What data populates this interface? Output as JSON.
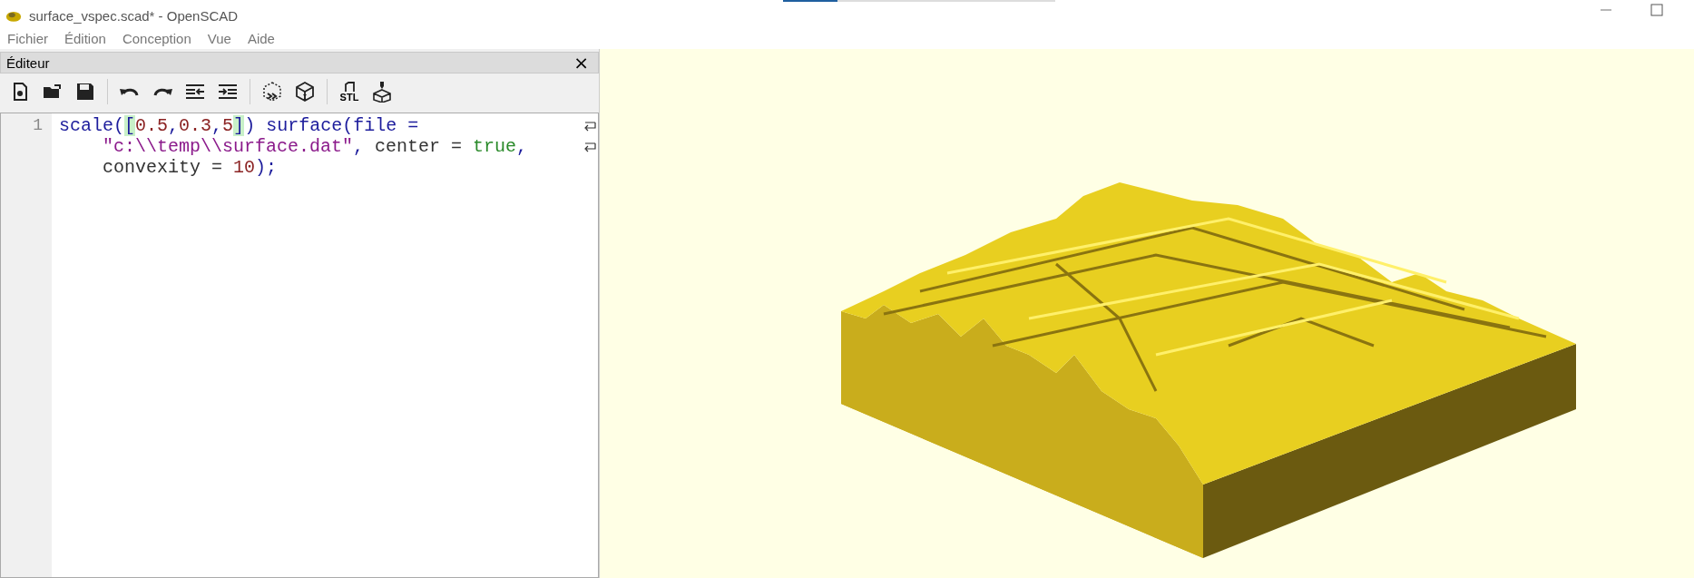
{
  "window": {
    "title": "surface_vspec.scad* - OpenSCAD"
  },
  "menu": [
    "Fichier",
    "Édition",
    "Conception",
    "Vue",
    "Aide"
  ],
  "editor": {
    "title": "Éditeur",
    "close": "×",
    "toolbar": [
      {
        "kind": "new"
      },
      {
        "kind": "open"
      },
      {
        "kind": "save"
      },
      {
        "kind": "separator"
      },
      {
        "kind": "undo"
      },
      {
        "kind": "redo"
      },
      {
        "kind": "unindent"
      },
      {
        "kind": "indent"
      },
      {
        "kind": "separator"
      },
      {
        "kind": "preview"
      },
      {
        "kind": "render"
      },
      {
        "kind": "separator"
      },
      {
        "kind": "export",
        "label": "STL"
      },
      {
        "kind": "print"
      }
    ],
    "lines": [
      {
        "number": "1",
        "rows": [
          {
            "wrapped": true,
            "segments": [
              {
                "kind": "code",
                "text": "scale("
              },
              {
                "kind": "match",
                "text": "["
              },
              {
                "kind": "number",
                "text": "0.5"
              },
              {
                "kind": "code",
                "text": ","
              },
              {
                "kind": "number",
                "text": "0.3"
              },
              {
                "kind": "code",
                "text": ","
              },
              {
                "kind": "number",
                "text": "5"
              },
              {
                "kind": "match",
                "text": "]"
              },
              {
                "kind": "code",
                "text": ") surface(file ="
              }
            ]
          },
          {
            "wrapped": true,
            "segments": [
              {
                "kind": "string",
                "text": "\"c:\\\\temp\\\\surface.dat\""
              },
              {
                "kind": "code",
                "text": ", "
              },
              {
                "kind": "plain",
                "text": "center = "
              },
              {
                "kind": "bool",
                "text": "true"
              },
              {
                "kind": "code",
                "text": ","
              }
            ]
          },
          {
            "wrapped": false,
            "segments": [
              {
                "kind": "plain",
                "text": "convexity = "
              },
              {
                "kind": "number",
                "text": "10"
              },
              {
                "kind": "code",
                "text": ");"
              }
            ]
          }
        ]
      }
    ]
  }
}
